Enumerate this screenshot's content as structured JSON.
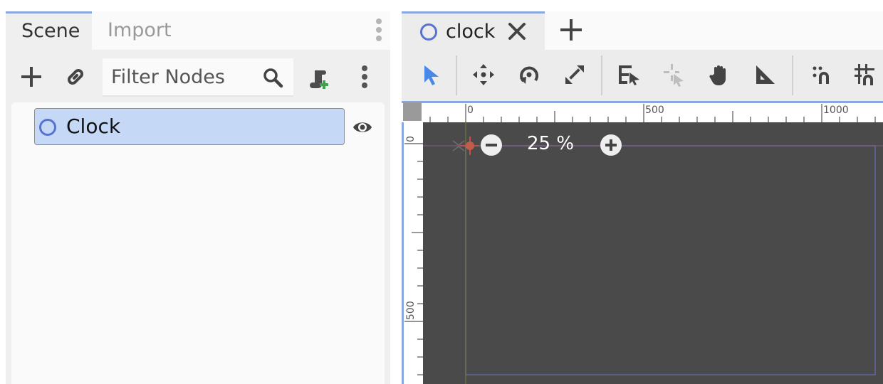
{
  "scene_dock": {
    "tabs": [
      {
        "label": "Scene",
        "active": true
      },
      {
        "label": "Import",
        "active": false
      }
    ],
    "filter_placeholder": "Filter Nodes",
    "tree": [
      {
        "label": "Clock",
        "icon": "node2d-icon",
        "selected": true,
        "visible": true
      }
    ]
  },
  "editor": {
    "tabs": [
      {
        "label": "clock",
        "icon": "node2d-icon",
        "active": true
      }
    ],
    "toolbar_tools": [
      "select-tool-icon",
      "move-tool-icon",
      "rotate-tool-icon",
      "scale-tool-icon",
      "list-select-icon",
      "pivot-tool-icon",
      "pan-tool-icon",
      "ruler-tool-icon",
      "smart-snap-icon",
      "grid-snap-icon"
    ],
    "zoom": {
      "value": 25,
      "label": "25 %"
    },
    "ruler": {
      "top_labels": [
        "0",
        "500",
        "1000"
      ],
      "left_labels": [
        "0",
        "500"
      ]
    }
  },
  "colors": {
    "accent": "#8aa7e0",
    "node_icon": "#5872d2",
    "selection": "#c5d8f5",
    "canvas": "#4a4a4a"
  }
}
